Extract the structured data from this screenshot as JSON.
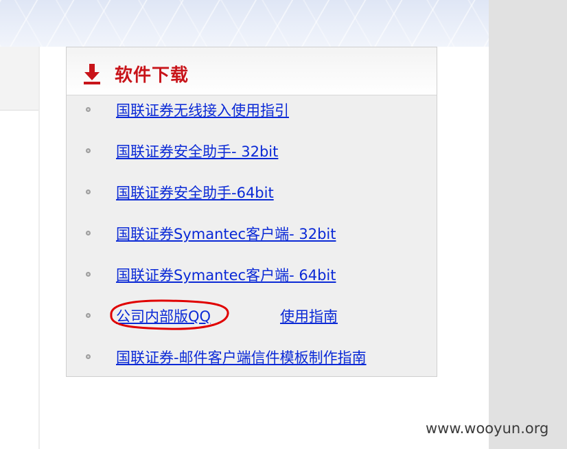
{
  "section": {
    "title": "软件下载",
    "icon": "download-arrow-icon",
    "title_color": "#c8141a"
  },
  "links": [
    {
      "label": "国联证券无线接入使用指引"
    },
    {
      "label": "国联证券安全助手- 32bit"
    },
    {
      "label": "国联证券安全助手-64bit"
    },
    {
      "label": "国联证券Symantec客户端- 32bit"
    },
    {
      "label": "国联证券Symantec客户端- 64bit"
    },
    {
      "label": "公司内部版QQ",
      "secondary_label": "使用指南",
      "highlighted": true
    },
    {
      "label": "国联证券-邮件客户端信件模板制作指南"
    }
  ],
  "colors": {
    "link": "#0a29d6",
    "annotation": "#e00000"
  },
  "watermark": "www.wooyun.org"
}
